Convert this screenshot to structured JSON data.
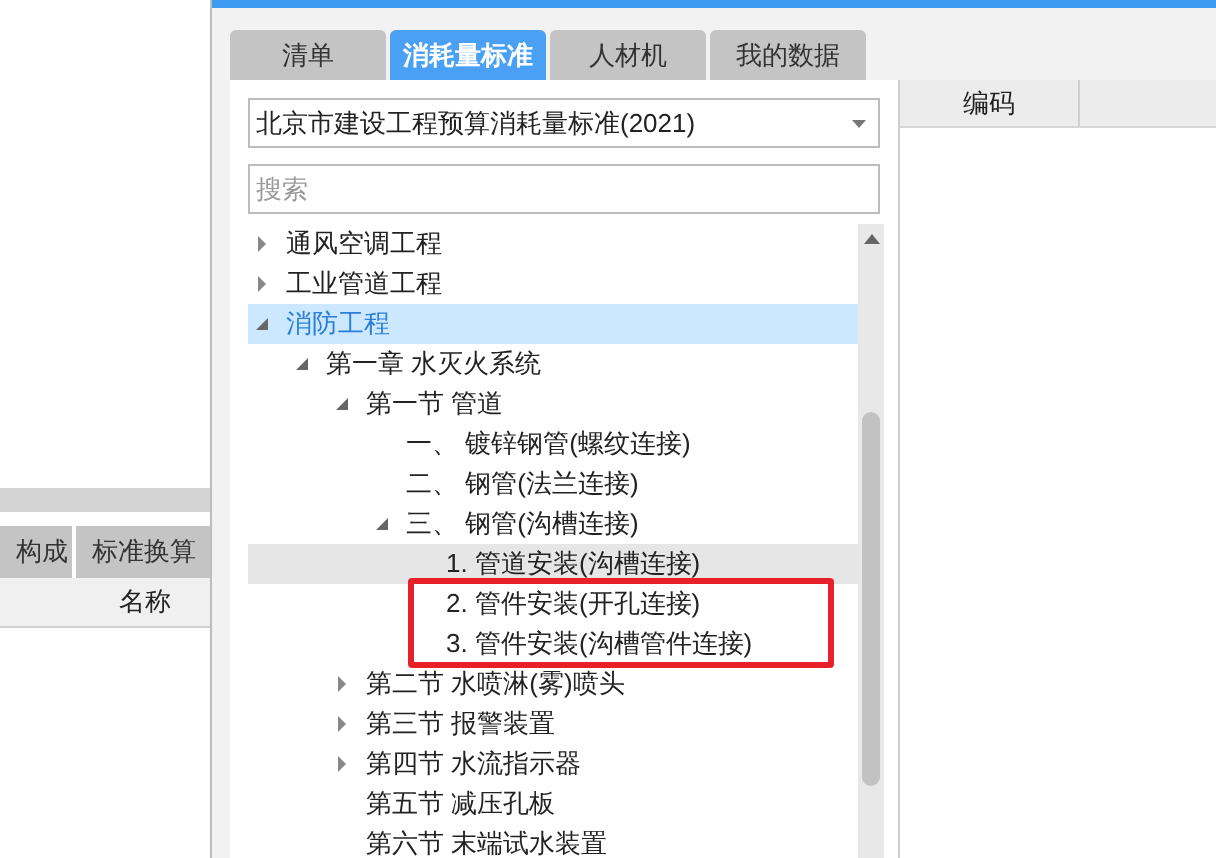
{
  "left_panel": {
    "tabs": [
      {
        "label": "构成",
        "selected": false
      },
      {
        "label": "标准换算",
        "selected": false
      }
    ],
    "columns": [
      "名称"
    ]
  },
  "tabs": [
    {
      "label": "清单",
      "selected": false
    },
    {
      "label": "消耗量标准",
      "selected": true
    },
    {
      "label": "人材机",
      "selected": false
    },
    {
      "label": "我的数据",
      "selected": false
    }
  ],
  "standard_select": {
    "value": "北京市建设工程预算消耗量标准(2021)"
  },
  "search": {
    "placeholder": "搜索"
  },
  "tree": [
    {
      "label": "通风空调工程",
      "expanded": false,
      "selected": false
    },
    {
      "label": "工业管道工程",
      "expanded": false,
      "selected": false
    },
    {
      "label": "消防工程",
      "expanded": true,
      "selected": true,
      "children": [
        {
          "label": "第一章 水灭火系统",
          "expanded": true,
          "selected": false,
          "children": [
            {
              "label": "第一节 管道",
              "expanded": true,
              "selected": false,
              "children": [
                {
                  "label": "一、 镀锌钢管(螺纹连接)",
                  "selected": false
                },
                {
                  "label": "二、 钢管(法兰连接)",
                  "selected": false
                },
                {
                  "label": "三、 钢管(沟槽连接)",
                  "expanded": true,
                  "selected": false,
                  "children": [
                    {
                      "label": "1. 管道安装(沟槽连接)",
                      "selected": false,
                      "highlighted": true
                    },
                    {
                      "label": "2. 管件安装(开孔连接)",
                      "selected": false,
                      "highlighted": false
                    },
                    {
                      "label": "3. 管件安装(沟槽管件连接)",
                      "selected": false,
                      "highlighted": false
                    }
                  ]
                }
              ]
            },
            {
              "label": "第二节 水喷淋(雾)喷头",
              "expanded": false,
              "selected": false
            },
            {
              "label": "第三节 报警装置",
              "expanded": false,
              "selected": false
            },
            {
              "label": "第四节 水流指示器",
              "expanded": false,
              "selected": false
            },
            {
              "label": "第五节 减压孔板",
              "selected": false
            },
            {
              "label": "第六节 末端试水装置",
              "selected": false
            }
          ]
        }
      ]
    }
  ],
  "right_table": {
    "columns": [
      "编码"
    ]
  }
}
